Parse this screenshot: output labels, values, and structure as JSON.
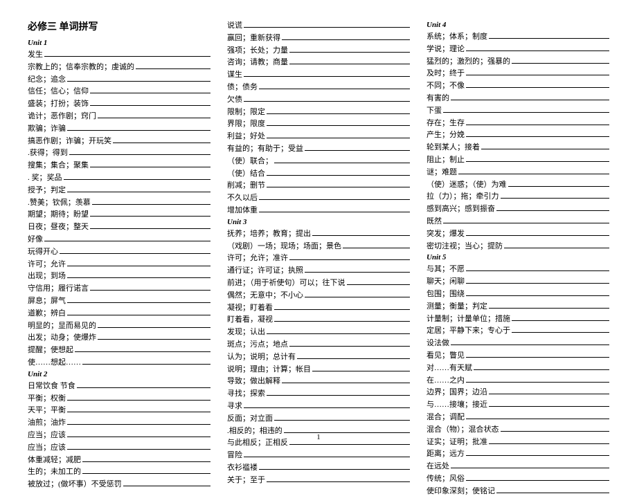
{
  "pageTitle": "必修三  单词拼写",
  "pageNumber": "1",
  "columns": [
    {
      "items": [
        {
          "type": "unit",
          "text": "Unit 1"
        },
        {
          "type": "entry",
          "text": "发生"
        },
        {
          "type": "entry",
          "text": "宗教上的；信奉宗教的；虔诚的"
        },
        {
          "type": "entry",
          "text": "纪念；追念"
        },
        {
          "type": "entry",
          "text": "信任；信心；信仰"
        },
        {
          "type": "entry",
          "text": "盛装；打扮；装饰"
        },
        {
          "type": "entry",
          "text": "诡计；恶作剧；窍门"
        },
        {
          "type": "entry",
          "text": "欺骗；诈骗"
        },
        {
          "type": "entry",
          "text": "  搞恶作剧；诈骗；开玩笑"
        },
        {
          "type": "entry",
          "text": ".获得；得到"
        },
        {
          "type": "entry",
          "text": "   搜集；集合；聚集"
        },
        {
          "type": "entry",
          "text": ". 奖；奖品"
        },
        {
          "type": "entry",
          "text": "授予；判定"
        },
        {
          "type": "entry",
          "text": ".赞美；钦佩；羡慕"
        },
        {
          "type": "entry",
          "text": "期望；期待；盼望"
        },
        {
          "type": "entry",
          "text": "日夜；昼夜；整天"
        },
        {
          "type": "entry",
          "text": "好像"
        },
        {
          "type": "entry",
          "text": "玩得开心"
        },
        {
          "type": "entry",
          "text": "许可；允许"
        },
        {
          "type": "entry",
          "text": "出现；到场"
        },
        {
          "type": "entry",
          "text": "守信用；履行诺言"
        },
        {
          "type": "entry",
          "text": "屏息；屏气"
        },
        {
          "type": "entry",
          "text": "道歉；辨白"
        },
        {
          "type": "entry",
          "text": "明显的；显而易见的"
        },
        {
          "type": "entry",
          "text": "出发；动身；使爆炸"
        },
        {
          "type": "entry",
          "text": "提醒；使想起"
        },
        {
          "type": "entry",
          "text": "使……想起……"
        },
        {
          "type": "unit",
          "text": "Unit 2"
        },
        {
          "type": "entry",
          "text": "日常饮食  节食"
        },
        {
          "type": "entry",
          "text": "平衡；权衡"
        },
        {
          "type": "entry",
          "text": "    天平；平衡"
        },
        {
          "type": "entry",
          "text": "油煎；油炸"
        },
        {
          "type": "entry",
          "text": "应当；应该"
        },
        {
          "type": "entry",
          "text": "应当；应该"
        },
        {
          "type": "entry",
          "text": "体重减轻；减肥"
        },
        {
          "type": "entry",
          "text": "生的；未加工的"
        },
        {
          "type": "entry",
          "text": "被放过；(做坏事）不受惩罚"
        }
      ]
    },
    {
      "items": [
        {
          "type": "entry",
          "text": "说谎"
        },
        {
          "type": "entry",
          "text": "赢回；重新获得"
        },
        {
          "type": "entry",
          "text": "强项；长处；力量"
        },
        {
          "type": "entry",
          "text": "咨询；请教；商量"
        },
        {
          "type": "entry",
          "text": "谋生"
        },
        {
          "type": "entry",
          "text": "债；债务"
        },
        {
          "type": "entry",
          "text": "欠债"
        },
        {
          "type": "entry",
          "text": "限制；限定"
        },
        {
          "type": "entry",
          "text": "  界限；限度"
        },
        {
          "type": "entry",
          "text": "利益；好处"
        },
        {
          "type": "entry",
          "text": "有益的；有助于；受益"
        },
        {
          "type": "entry",
          "text": "（使）联合；"
        },
        {
          "type": "entry",
          "text": "    （使）结合"
        },
        {
          "type": "entry",
          "text": "削减；删节"
        },
        {
          "type": "entry",
          "text": "不久以后"
        },
        {
          "type": "entry",
          "text": "增加体重"
        },
        {
          "type": "unit",
          "text": "Unit 3"
        },
        {
          "type": "entry",
          "text": "抚养；培养；教育；提出"
        },
        {
          "type": "entry",
          "text": "（戏剧）一场；现场；场面；景色"
        },
        {
          "type": "entry",
          "text": "许可；允许；准许"
        },
        {
          "type": "entry",
          "text": "  通行证；许可证；执照"
        },
        {
          "type": "entry",
          "text": "前进；（用于祈使句）可以；往下说"
        },
        {
          "type": "entry",
          "text": "偶然；无意中；不小心"
        },
        {
          "type": "entry",
          "text": "凝视；盯着看"
        },
        {
          "type": "entry",
          "text": "盯着看，凝视"
        },
        {
          "type": "entry",
          "text": "发现；认出"
        },
        {
          "type": "entry",
          "text": "斑点；污点；地点"
        },
        {
          "type": "entry",
          "text": "认为；说明；总计有"
        },
        {
          "type": "entry",
          "text": "说明；理由；计算；帐目"
        },
        {
          "type": "entry",
          "text": "导致；做出解释"
        },
        {
          "type": "entry",
          "text": "寻找；探索"
        },
        {
          "type": "entry",
          "text": "寻求"
        },
        {
          "type": "entry",
          "text": "反面；对立面"
        },
        {
          "type": "entry",
          "text": ".相反的；相违的"
        },
        {
          "type": "entry",
          "text": "与此相反；正相反"
        },
        {
          "type": "entry",
          "text": "冒险"
        },
        {
          "type": "entry",
          "text": "衣衫褴褛"
        },
        {
          "type": "entry",
          "text": "关于；至于"
        }
      ]
    },
    {
      "items": [
        {
          "type": "unit",
          "text": "Unit 4"
        },
        {
          "type": "entry",
          "text": "系统；体系；制度"
        },
        {
          "type": "entry",
          "text": "学说；理论"
        },
        {
          "type": "entry",
          "text": "猛烈的；激烈的；强暴的"
        },
        {
          "type": "entry",
          "text": "及时；终于"
        },
        {
          "type": "entry",
          "text": "不同；不像"
        },
        {
          "type": "entry",
          "text": "有害的"
        },
        {
          "type": "entry",
          "text": "下蛋"
        },
        {
          "type": "entry",
          "text": "存在；生存"
        },
        {
          "type": "entry",
          "text": "产生；分娩"
        },
        {
          "type": "entry",
          "text": "轮到某人；接着"
        },
        {
          "type": "entry",
          "text": "阻止；制止"
        },
        {
          "type": "entry",
          "text": "谜；难题"
        },
        {
          "type": "entry",
          "text": "（使）迷惑；（使）为难"
        },
        {
          "type": "entry",
          "text": "拉（力）；拖；牵引力"
        },
        {
          "type": "entry",
          "text": "感到高兴；感到振奋"
        },
        {
          "type": "entry",
          "text": "既然"
        },
        {
          "type": "entry",
          "text": "突发；爆发"
        },
        {
          "type": "entry",
          "text": "密切注视；当心；提防"
        },
        {
          "type": "unit",
          "text": "Unit 5"
        },
        {
          "type": "entry",
          "text": "与其；不愿"
        },
        {
          "type": "entry",
          "text": "聊天；闲聊"
        },
        {
          "type": "entry",
          "text": "包围；围绕"
        },
        {
          "type": "entry",
          "text": "测量；衡量；判定"
        },
        {
          "type": "entry",
          "text": "  计量制；计量单位；措施"
        },
        {
          "type": "entry",
          "text": "定居；平静下来；专心于"
        },
        {
          "type": "entry",
          "text": "设法做"
        },
        {
          "type": "entry",
          "text": "看见；瞥见"
        },
        {
          "type": "entry",
          "text": "对……有天赋"
        },
        {
          "type": "entry",
          "text": "在……之内"
        },
        {
          "type": "entry",
          "text": "边界；国界；边沿"
        },
        {
          "type": "entry",
          "text": "与……接壤；接近"
        },
        {
          "type": "entry",
          "text": "混合；调配"
        },
        {
          "type": "entry",
          "text": "  混合（物）；混合状态"
        },
        {
          "type": "entry",
          "text": "证实；证明；批准"
        },
        {
          "type": "entry",
          "text": "距离；远方"
        },
        {
          "type": "entry",
          "text": "在远处"
        },
        {
          "type": "entry",
          "text": "传统；风俗"
        },
        {
          "type": "entry",
          "text": "使印象深刻；使铭记"
        }
      ]
    }
  ]
}
